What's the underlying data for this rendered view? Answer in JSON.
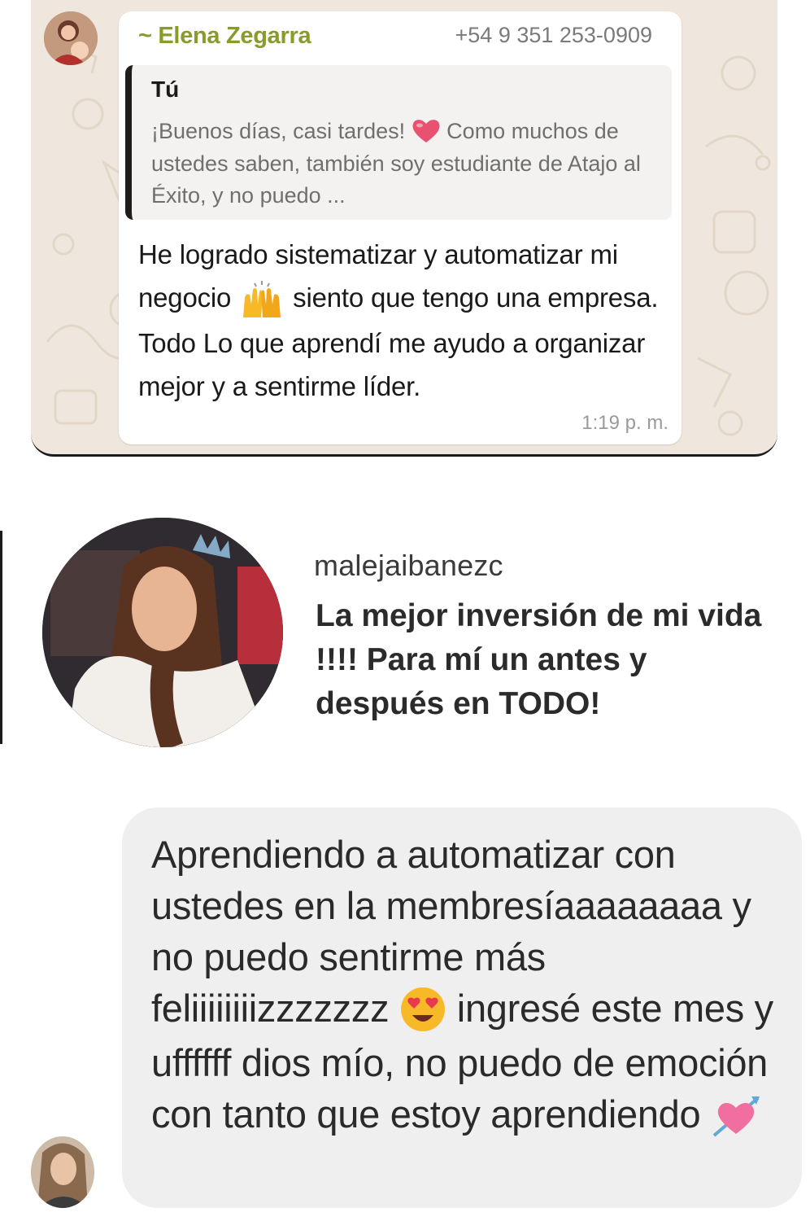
{
  "whatsapp": {
    "sender_name": "~ Elena Zegarra",
    "sender_phone": "+54 9 351 253-0909",
    "quote": {
      "author": "Tú",
      "text_before_emoji": "¡Buenos días, casi tardes! ",
      "emoji": "heart-icon",
      "text_after_emoji": " Como muchos de ustedes saben, también soy estudiante de Atajo al Éxito, y no puedo ..."
    },
    "message": {
      "part1": "He logrado sistematizar y automatizar mi negocio ",
      "emoji": "raising-hands-icon",
      "part2": " siento que tengo una empresa. Todo Lo que aprendí me ayudo a organizar mejor y a sentirme líder."
    },
    "time": "1:19 p. m."
  },
  "instagram": {
    "username": "malejaibanezc",
    "comment": "La mejor inversión de mi vida !!!! Para mí un antes y después en TODO!"
  },
  "messenger": {
    "part1": "Aprendiendo a automatizar con ustedes en la membresíaaaaaaaa y no puedo sentirme más feliiiiiiiizzzzzzz ",
    "emoji1": "heart-eyes-icon",
    "part2": " ingresé este mes y uffffff dios mío, no puedo de emoción con tanto que estoy aprendiendo ",
    "emoji2": "heart-with-arrow-icon"
  },
  "colors": {
    "whatsapp_background": "#efe7dd",
    "whatsapp_sender": "#8a9a2c",
    "bubble_white": "#ffffff",
    "messenger_bubble": "#efefef",
    "emoji_heart": "#e8516f",
    "emoji_yellow": "#f7b928"
  }
}
